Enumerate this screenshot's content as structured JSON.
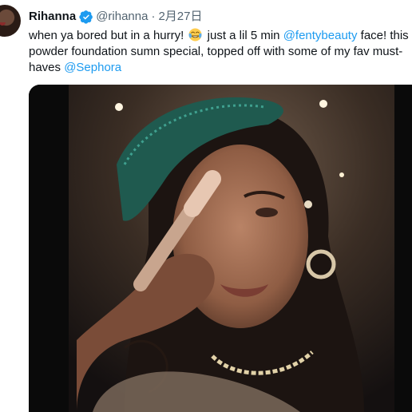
{
  "tweet": {
    "author_name": "Rihanna",
    "handle": "@rihanna",
    "separator": "·",
    "date": "2月27日",
    "text_part1": "when ya bored but in a hurry!",
    "emoji": "face-with-tears-of-joy",
    "text_part2": "just a lil 5 min",
    "mention_fentybeauty": "@fentybeauty",
    "text_part3": "face! this powder foundation sumn special, topped off with some of my fav must-haves",
    "mention_sephora": "@Sephora"
  },
  "colors": {
    "link": "#1d9bf0",
    "verified": "#1d9bf0",
    "secondary_text": "#536471"
  },
  "media": {
    "kind": "video-still",
    "icon": "video-frame"
  }
}
